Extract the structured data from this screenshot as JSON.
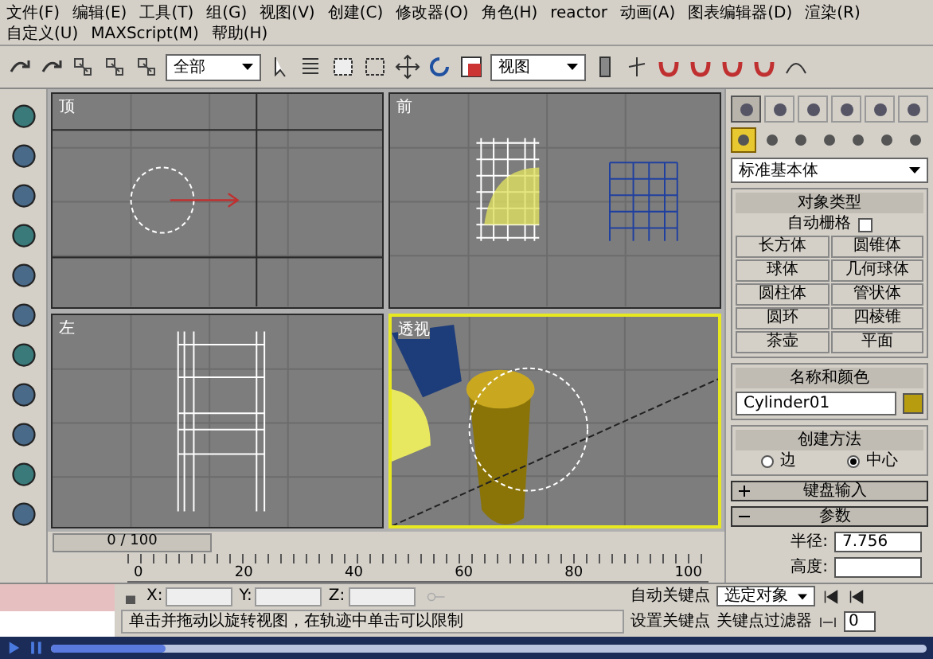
{
  "menu": [
    {
      "label": "文件(F)"
    },
    {
      "label": "编辑(E)"
    },
    {
      "label": "工具(T)"
    },
    {
      "label": "组(G)"
    },
    {
      "label": "视图(V)"
    },
    {
      "label": "创建(C)"
    },
    {
      "label": "修改器(O)"
    },
    {
      "label": "角色(H)"
    },
    {
      "label": "reactor"
    },
    {
      "label": "动画(A)"
    },
    {
      "label": "图表编辑器(D)"
    },
    {
      "label": "渲染(R)"
    },
    {
      "label": "自定义(U)"
    },
    {
      "label": "MAXScript(M)"
    },
    {
      "label": "帮助(H)"
    }
  ],
  "toolbar": {
    "selection_filter": "全部",
    "reference_coordinates": "视图"
  },
  "viewports": [
    {
      "label": "顶",
      "kind": "top",
      "selected": false
    },
    {
      "label": "前",
      "kind": "front",
      "selected": false
    },
    {
      "label": "左",
      "kind": "left",
      "selected": false
    },
    {
      "label": "透视",
      "kind": "perspective",
      "selected": true
    }
  ],
  "command_panel": {
    "tabs": [
      {
        "selected": true
      },
      {
        "selected": false
      },
      {
        "selected": false
      },
      {
        "selected": false
      },
      {
        "selected": false
      },
      {
        "selected": false
      }
    ],
    "categories": [
      {
        "selected": true
      },
      {
        "selected": false
      },
      {
        "selected": false
      },
      {
        "selected": false
      },
      {
        "selected": false
      },
      {
        "selected": false
      },
      {
        "selected": false
      }
    ],
    "dropdown": "标准基本体",
    "object_type": {
      "title": "对象类型",
      "autogrid": {
        "label": "自动栅格",
        "checked": false
      },
      "buttons": [
        "长方体",
        "圆锥体",
        "球体",
        "几何球体",
        "圆柱体",
        "管状体",
        "圆环",
        "四棱锥",
        "茶壶",
        "平面"
      ]
    },
    "name_and_color": {
      "title": "名称和颜色",
      "name": "Cylinder01",
      "color": "#b89c10"
    },
    "creation_method": {
      "title": "创建方法",
      "options": [
        {
          "label": "边",
          "selected": false
        },
        {
          "label": "中心",
          "selected": true
        }
      ]
    },
    "rollouts": [
      {
        "title": "键盘输入",
        "expanded": false
      },
      {
        "title": "参数",
        "expanded": true
      }
    ],
    "parameters": [
      {
        "label": "半径:",
        "value": "7.756"
      },
      {
        "label": "高度:"
      }
    ]
  },
  "timeline": {
    "frame": "0 / 100",
    "ticks": [
      "0",
      "20",
      "40",
      "60",
      "80",
      "100"
    ]
  },
  "coordinates": [
    {
      "label": "X:"
    },
    {
      "label": "Y:"
    },
    {
      "label": "Z:"
    }
  ],
  "status": "单击并拖动以旋转视图，在轨迹中单击可以限制",
  "animation": {
    "auto_key": "自动关键点",
    "key_mode": "选定对象",
    "set_key": "设置关键点",
    "key_filters": "关键点过滤器",
    "frame": "0"
  },
  "player": {
    "level": 0.13
  }
}
